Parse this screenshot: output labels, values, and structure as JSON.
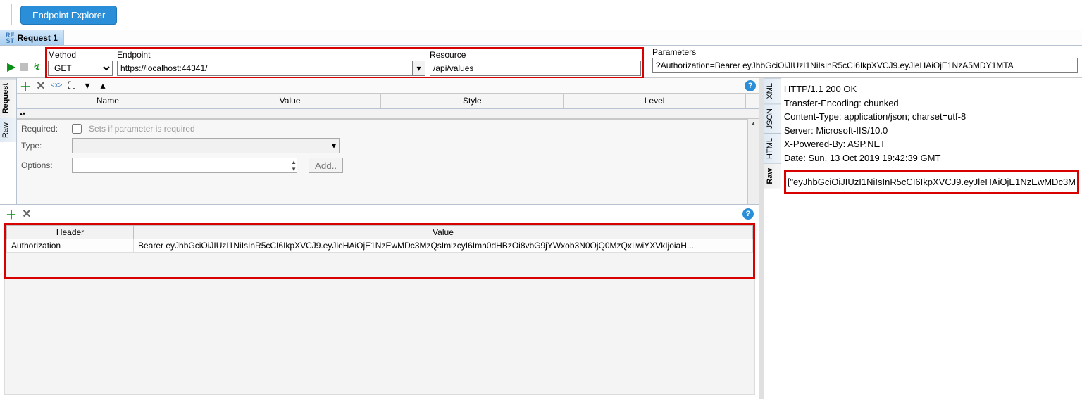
{
  "toolbar": {
    "endpoint_explorer": "Endpoint Explorer"
  },
  "tab": {
    "rest_marker_top": "RE",
    "rest_marker_bot": "ST",
    "title": "Request 1"
  },
  "request_bar": {
    "method_label": "Method",
    "method_value": "GET",
    "endpoint_label": "Endpoint",
    "endpoint_value": "https://localhost:44341/",
    "resource_label": "Resource",
    "resource_value": "/api/values",
    "parameters_label": "Parameters",
    "parameters_value": "?Authorization=Bearer eyJhbGciOiJIUzI1NiIsInR5cCI6IkpXVCJ9.eyJleHAiOjE1NzA5MDY1MTA"
  },
  "left_side_tabs": [
    "Request",
    "Raw"
  ],
  "param_table": {
    "columns": [
      "Name",
      "Value",
      "Style",
      "Level"
    ],
    "required_label": "Required:",
    "required_hint": "Sets if parameter is required",
    "type_label": "Type:",
    "options_label": "Options:",
    "add_button": "Add.."
  },
  "headers_table": {
    "columns": [
      "Header",
      "Value"
    ],
    "rows": [
      {
        "header": "Authorization",
        "value": "Bearer eyJhbGciOiJIUzI1NiIsInR5cCI6IkpXVCJ9.eyJleHAiOjE1NzEwMDc3MzQsImlzcyI6Imh0dHBzOi8vbG9jYWxob3N0OjQ0MzQxIiwiYXVkIjoiaH..."
      }
    ]
  },
  "right_side_tabs": [
    "XML",
    "JSON",
    "HTML",
    "Raw"
  ],
  "response": {
    "lines": [
      "HTTP/1.1 200 OK",
      "Transfer-Encoding: chunked",
      "Content-Type: application/json; charset=utf-8",
      "Server: Microsoft-IIS/10.0",
      "X-Powered-By: ASP.NET",
      "Date: Sun, 13 Oct 2019 19:42:39 GMT"
    ],
    "body": "[\"eyJhbGciOiJIUzI1NiIsInR5cCI6IkpXVCJ9.eyJleHAiOjE1NzEwMDc3M"
  }
}
